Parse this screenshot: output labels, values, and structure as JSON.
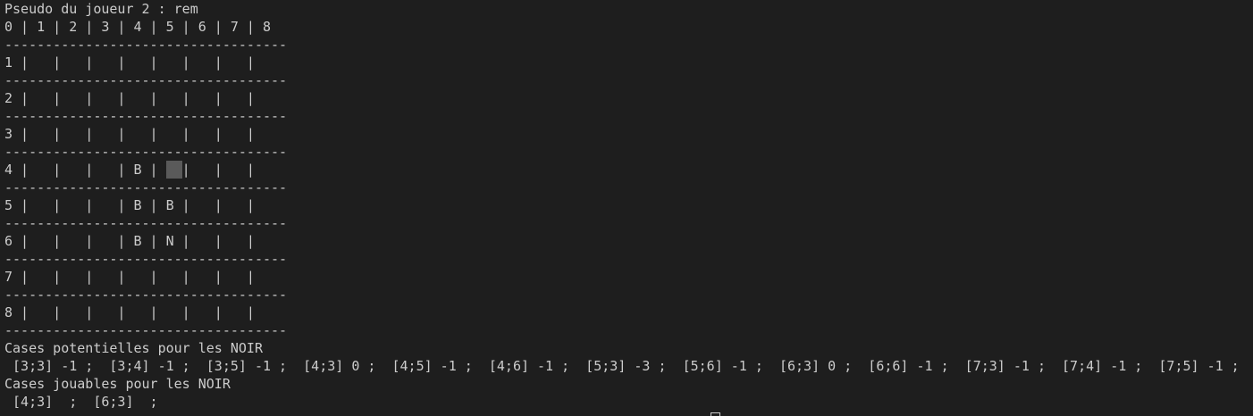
{
  "terminal": {
    "player_prompt": "Pseudo du joueur 2 : rem",
    "column_header": "0 | 1 | 2 | 3 | 4 | 5 | 6 | 7 | 8",
    "separator": "-----------------------------------",
    "rows": [
      "1 |   |   |   |   |   |   |   |",
      "2 |   |   |   |   |   |   |   |",
      "3 |   |   |   |   |   |   |   |",
      {
        "before": "4 |   |   |   | B |",
        "highlight": true,
        "after": "|   |   |"
      },
      "5 |   |   |   | B | B |   |   |",
      "6 |   |   |   | B | N |   |   |",
      "7 |   |   |   |   |   |   |   |",
      "8 |   |   |   |   |   |   |   |"
    ],
    "potential_heading": "Cases potentielles pour les NOIR",
    "potential_cells": " [3;3] -1 ;  [3;4] -1 ;  [3;5] -1 ;  [4;3] 0 ;  [4;5] -1 ;  [4;6] -1 ;  [5;3] -3 ;  [5;6] -1 ;  [6;3] 0 ;  [6;6] -1 ;  [7;3] -1 ;  [7;4] -1 ;  [7;5] -1 ;",
    "playable_heading": "Cases jouables pour les NOIR",
    "playable_cells": " [4;3]  ;  [6;3]  ;"
  },
  "colors": {
    "background": "#1e1e1e",
    "text": "#cccccc",
    "highlight": "#5a5a5a"
  }
}
